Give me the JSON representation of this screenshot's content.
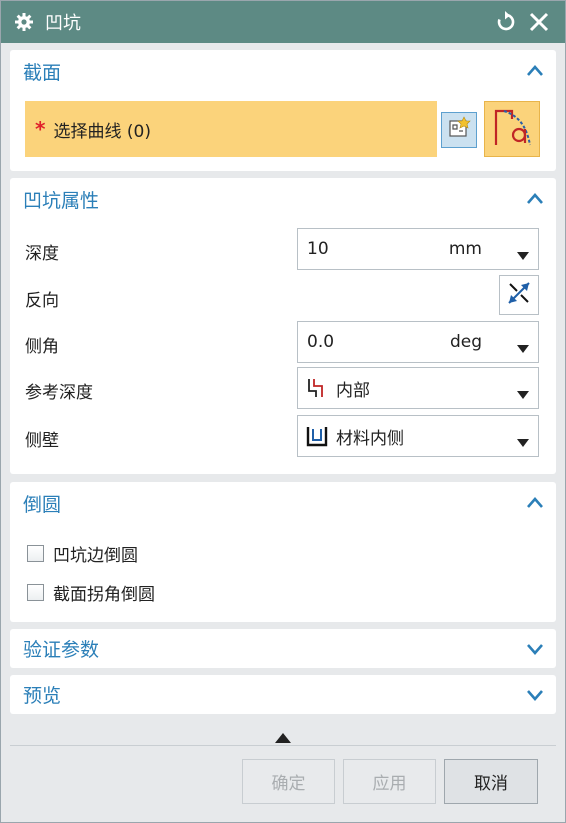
{
  "window": {
    "title": "凹坑"
  },
  "section": {
    "title": "截面",
    "required_marker": "*",
    "select_curve_label": "选择曲线 (0)"
  },
  "properties": {
    "title": "凹坑属性",
    "depth": {
      "label": "深度",
      "value": "10",
      "unit": "mm"
    },
    "reverse": {
      "label": "反向"
    },
    "side_angle": {
      "label": "侧角",
      "value": "0.0",
      "unit": "deg"
    },
    "ref_depth": {
      "label": "参考深度",
      "value": "内部"
    },
    "side_wall": {
      "label": "侧壁",
      "value": "材料内侧"
    }
  },
  "fillet": {
    "title": "倒圆",
    "options": [
      {
        "label": "凹坑边倒圆",
        "checked": false
      },
      {
        "label": "截面拐角倒圆",
        "checked": false
      }
    ]
  },
  "validation": {
    "title": "验证参数"
  },
  "preview": {
    "title": "预览"
  },
  "buttons": {
    "ok": "确定",
    "apply": "应用",
    "cancel": "取消"
  },
  "colors": {
    "titlebar": "#5d8a84",
    "accent": "#2b7fb8",
    "selection": "#fbd37b",
    "required": "#e0202a"
  }
}
